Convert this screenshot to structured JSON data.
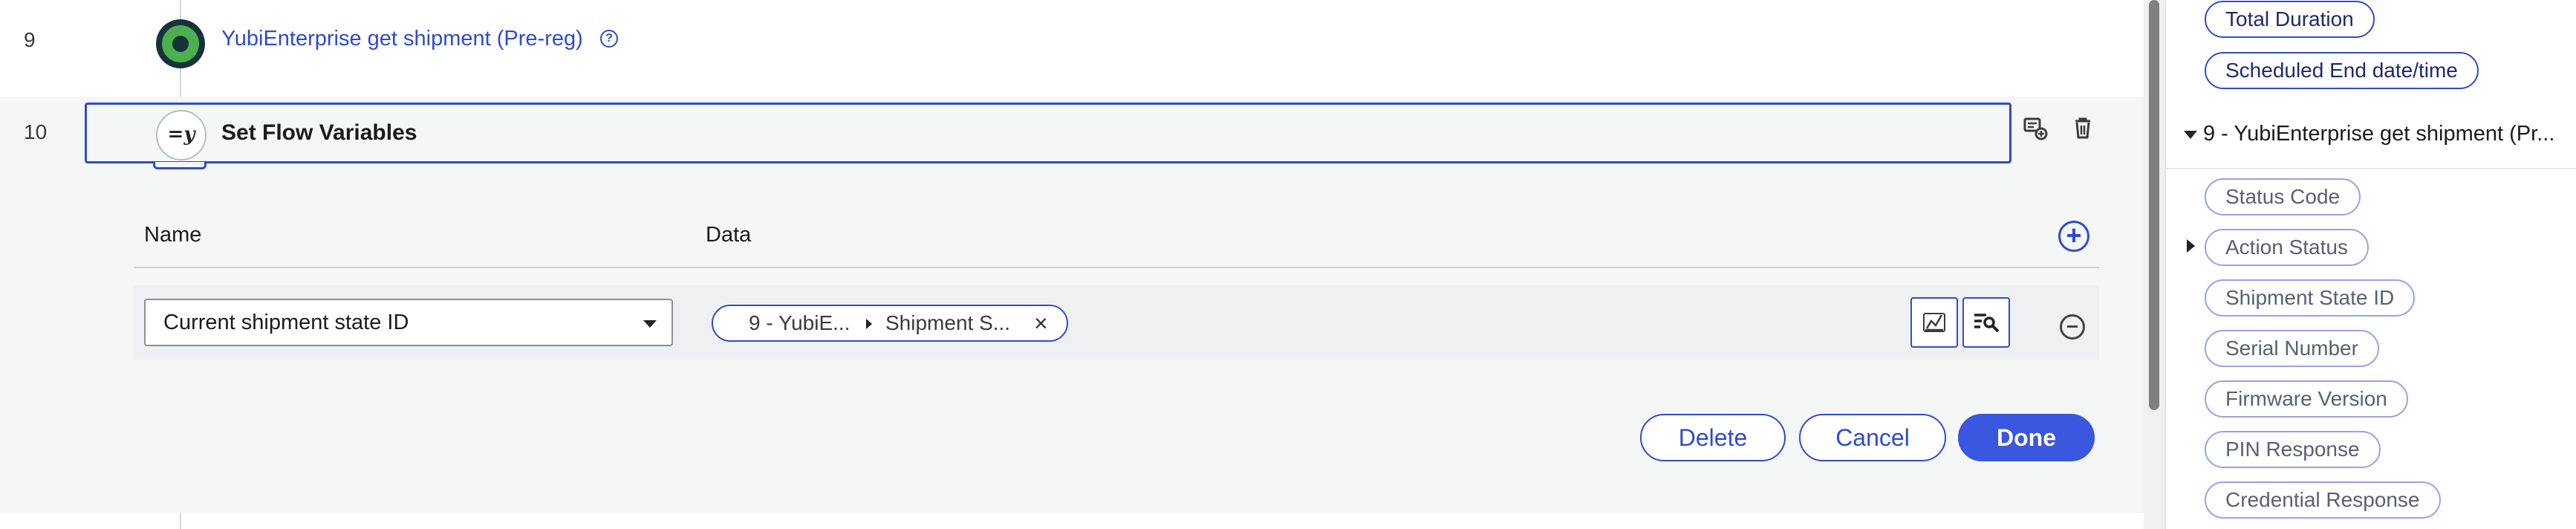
{
  "flow": {
    "step9": {
      "number": "9",
      "title": "YubiEnterprise get shipment (Pre-reg)",
      "help_icon": "?"
    },
    "step10": {
      "number": "10",
      "title": "Set Flow Variables",
      "icon_text": "=y"
    }
  },
  "editor": {
    "columns": {
      "name": "Name",
      "data": "Data"
    },
    "add_icon": "+",
    "rows": [
      {
        "name_value": "Current shipment state ID",
        "data_pill": {
          "segment1": "9 - YubiE...",
          "segment2": "Shipment S...",
          "remove_icon": "×"
        }
      }
    ],
    "buttons": {
      "delete": "Delete",
      "cancel": "Cancel",
      "done": "Done"
    }
  },
  "panel": {
    "top_chips": [
      "Total Duration",
      "Scheduled End date/time"
    ],
    "section_title": "9 - YubiEnterprise get shipment (Pr...",
    "section_chips": [
      "Status Code",
      "Action Status",
      "Shipment State ID",
      "Serial Number",
      "Firmware Version",
      "PIN Response",
      "Credential Response"
    ]
  },
  "colors": {
    "accent": "#2f4bd1",
    "primary_button": "#3a57e0",
    "node_green": "#4caf50",
    "editor_background": "#f5f6f6"
  },
  "icons": {
    "step9": "connector-node-icon",
    "step10": "set-variables-icon",
    "copy_step": "copy-step-icon",
    "delete_step": "trash-icon",
    "editor_tool_1": "expression-icon",
    "editor_tool_2": "data-picker-icon",
    "remove_row": "minus-circle-icon"
  }
}
